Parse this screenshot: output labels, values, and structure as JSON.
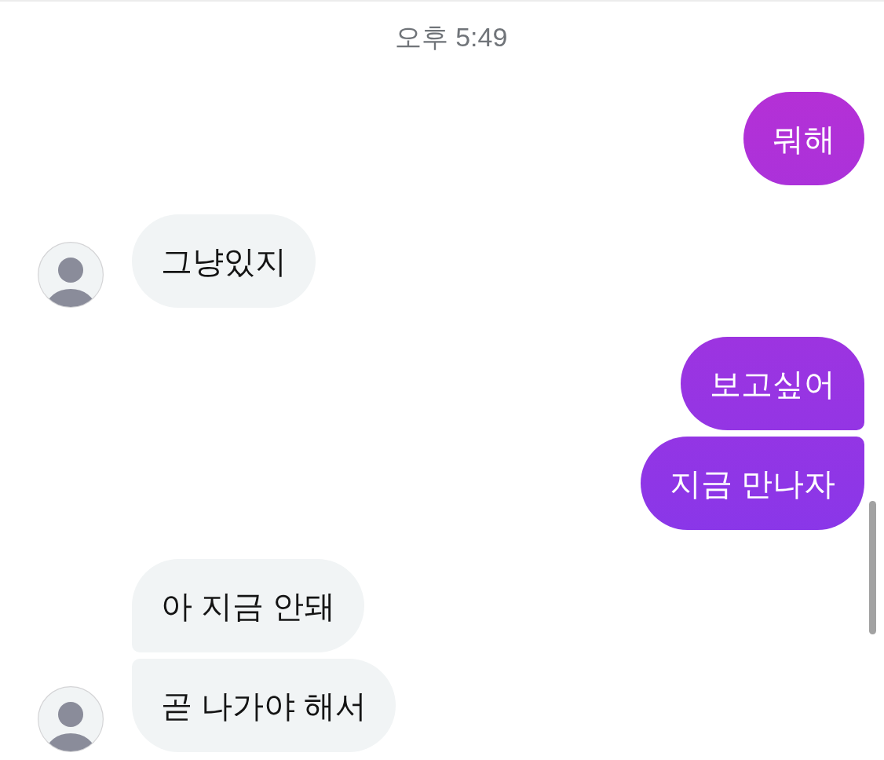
{
  "timestamp": "오후 5:49",
  "messages": [
    {
      "kind": "outgoing",
      "joined_above": false,
      "joined_below": false,
      "text": "뭐해"
    },
    {
      "kind": "incoming",
      "joined_above": false,
      "joined_below": false,
      "text": "그냥있지"
    },
    {
      "kind": "outgoing",
      "joined_above": false,
      "joined_below": true,
      "text": "보고싶어"
    },
    {
      "kind": "outgoing",
      "joined_above": true,
      "joined_below": false,
      "text": "지금 만나자"
    },
    {
      "kind": "incoming",
      "joined_above": false,
      "joined_below": true,
      "text": "아 지금 안돼"
    },
    {
      "kind": "incoming",
      "joined_above": true,
      "joined_below": false,
      "text": "곧 나가야 해서"
    }
  ]
}
